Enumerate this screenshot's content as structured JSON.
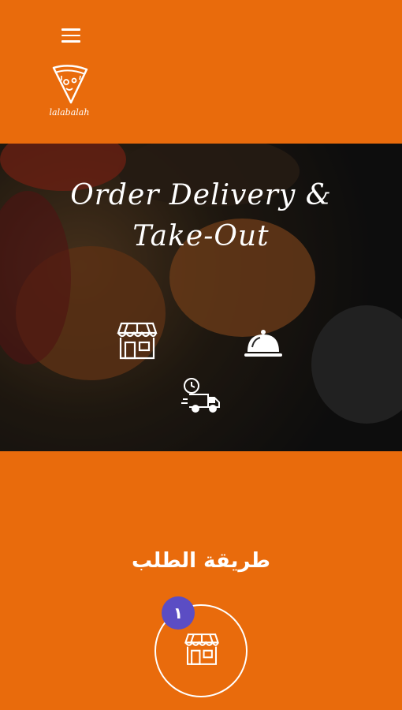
{
  "header": {
    "logo_text": "lalabalah"
  },
  "hero": {
    "title_line1": "Order Delivery &",
    "title_line2": "Take-Out",
    "icons": [
      "store-icon",
      "serving-cloche-icon",
      "delivery-truck-clock-icon"
    ]
  },
  "order_method": {
    "title": "طريقة الطلب",
    "step_number": "١",
    "step_icon": "store-icon"
  },
  "colors": {
    "brand_orange": "#e96b0c",
    "badge_purple": "#5b4dc4"
  }
}
